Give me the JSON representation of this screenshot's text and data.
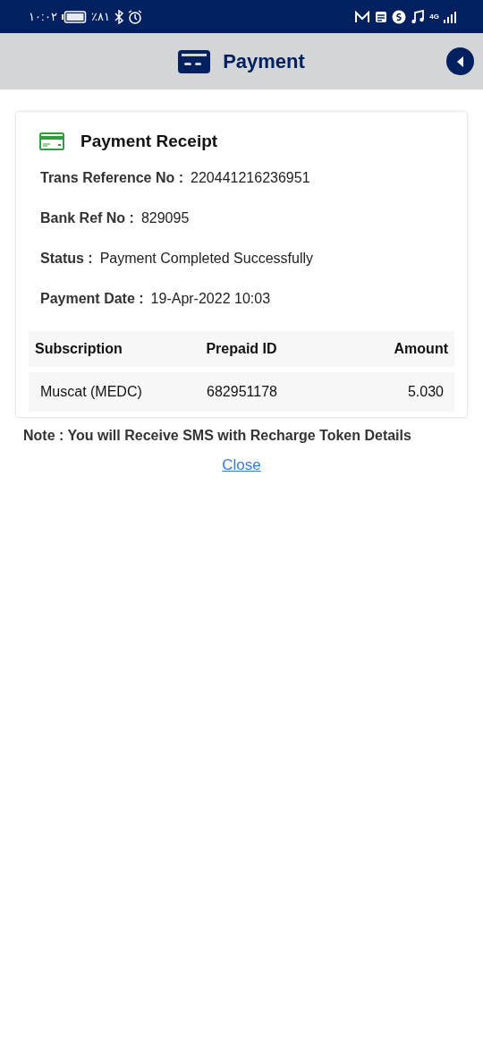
{
  "status_bar": {
    "time": "١٠:٠٢",
    "battery": "٪٨١",
    "network": "4G"
  },
  "header": {
    "title": "Payment"
  },
  "receipt": {
    "title": "Payment Receipt",
    "fields": [
      {
        "label": "Trans Reference No :",
        "value": "220441216236951"
      },
      {
        "label": "Bank Ref No :",
        "value": "829095"
      },
      {
        "label": "Status :",
        "value": "Payment Completed Successfully"
      },
      {
        "label": "Payment Date :",
        "value": "19-Apr-2022 10:03"
      }
    ],
    "table": {
      "columns": [
        "Subscription",
        "Prepaid ID",
        "Amount"
      ],
      "rows": [
        [
          "Muscat (MEDC)",
          "682951178",
          "5.030"
        ]
      ]
    }
  },
  "note": "Note : You will Receive SMS with Recharge Token Details",
  "close_link": "Close"
}
